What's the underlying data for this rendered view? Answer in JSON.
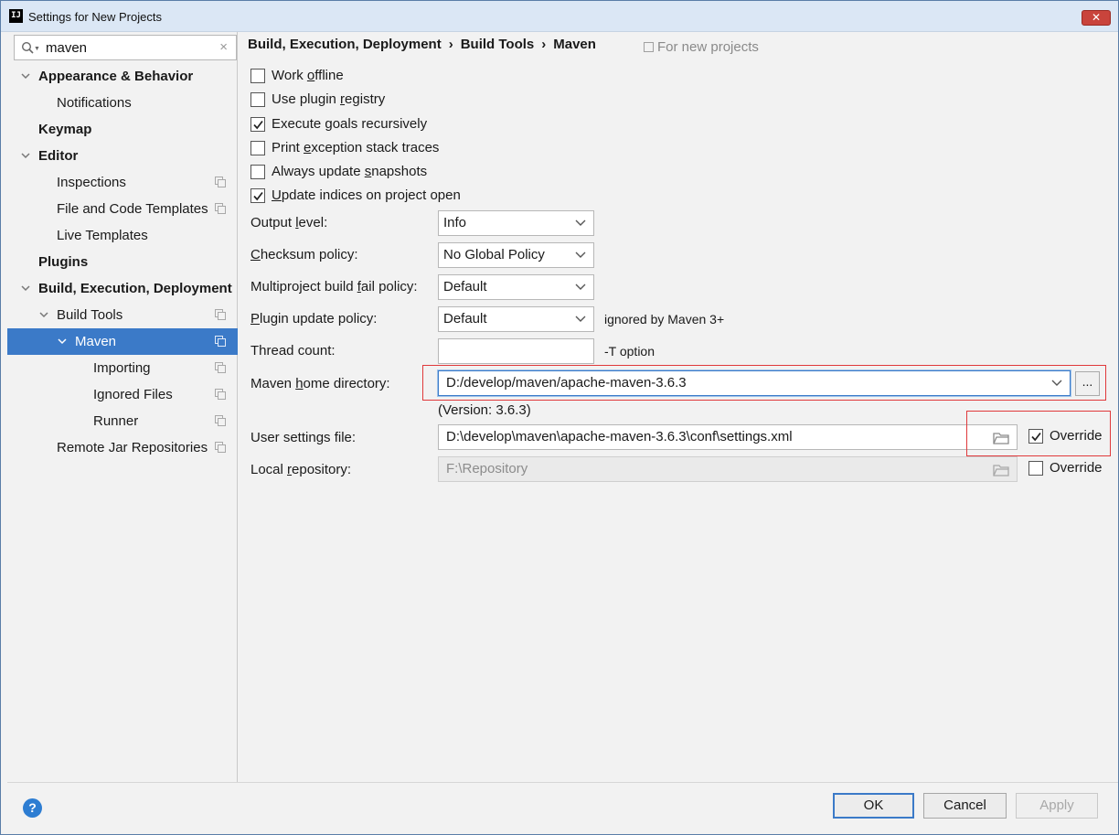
{
  "window": {
    "title": "Settings for New Projects",
    "logo": "IJ",
    "close_icon": "close-icon"
  },
  "search": {
    "value": "maven",
    "clear": "×"
  },
  "tree": [
    {
      "label": "Appearance & Behavior",
      "level": 0,
      "bold": true,
      "expanded": true
    },
    {
      "label": "Notifications",
      "level": 1
    },
    {
      "label": "Keymap",
      "level": 0,
      "bold": true
    },
    {
      "label": "Editor",
      "level": 0,
      "bold": true,
      "expanded": true
    },
    {
      "label": "Inspections",
      "level": 1,
      "project": true
    },
    {
      "label": "File and Code Templates",
      "level": 1,
      "project": true
    },
    {
      "label": "Live Templates",
      "level": 1
    },
    {
      "label": "Plugins",
      "level": 0,
      "bold": true
    },
    {
      "label": "Build, Execution, Deployment",
      "level": 0,
      "bold": true,
      "expanded": true
    },
    {
      "label": "Build Tools",
      "level": 1,
      "expanded": true,
      "project": true
    },
    {
      "label": "Maven",
      "level": 2,
      "expanded": true,
      "project": true,
      "selected": true
    },
    {
      "label": "Importing",
      "level": 3,
      "project": true
    },
    {
      "label": "Ignored Files",
      "level": 3,
      "project": true
    },
    {
      "label": "Runner",
      "level": 3,
      "project": true
    },
    {
      "label": "Remote Jar Repositories",
      "level": 1,
      "project": true
    }
  ],
  "breadcrumb": {
    "part1": "Build, Execution, Deployment",
    "part2": "Build Tools",
    "part3": "Maven",
    "sep": "›"
  },
  "for_new_projects": "For new projects",
  "checkboxes": {
    "work_offline": {
      "pre": "Work ",
      "ul": "o",
      "post": "ffline",
      "checked": false
    },
    "use_plugin_registry": {
      "pre": "Use plugin ",
      "ul": "r",
      "post": "egistry",
      "checked": false
    },
    "execute_goals": {
      "pre": "Execute ",
      "ul": "g",
      "post": "oals recursively",
      "checked": true
    },
    "print_exception": {
      "pre": "Print ",
      "ul": "e",
      "post": "xception stack traces",
      "checked": false
    },
    "always_update": {
      "pre": "Always update ",
      "ul": "s",
      "post": "napshots",
      "checked": false
    },
    "update_indices": {
      "pre": "",
      "ul": "U",
      "post": "pdate indices on project open",
      "checked": true
    }
  },
  "fields": {
    "output_level": {
      "pre": "Output ",
      "ul": "l",
      "post": "evel:",
      "value": "Info"
    },
    "checksum_policy": {
      "pre": "",
      "ul": "C",
      "post": "hecksum policy:",
      "value": "No Global Policy"
    },
    "multiproject": {
      "pre": "Multiproject build ",
      "ul": "f",
      "post": "ail policy:",
      "value": "Default"
    },
    "plugin_update": {
      "pre": "",
      "ul": "P",
      "post": "lugin update policy:",
      "value": "Default",
      "hint": "ignored by Maven 3+"
    },
    "thread_count": {
      "label": "Thread count:",
      "value": "",
      "hint": "-T option"
    },
    "maven_home": {
      "pre": "Maven ",
      "ul": "h",
      "post": "ome directory:",
      "value": "D:/develop/maven/apache-maven-3.6.3",
      "browse": "...",
      "version": "(Version: 3.6.3)"
    },
    "user_settings": {
      "label": "User settings file:",
      "value": "D:\\develop\\maven\\apache-maven-3.6.3\\conf\\settings.xml",
      "override_label": "Override",
      "override_checked": true
    },
    "local_repo": {
      "pre": "Local ",
      "ul": "r",
      "post": "epository:",
      "value": "F:\\Repository",
      "override_label": "Override",
      "override_checked": false
    }
  },
  "buttons": {
    "help": "?",
    "ok": "OK",
    "cancel": "Cancel",
    "apply": "Apply"
  }
}
